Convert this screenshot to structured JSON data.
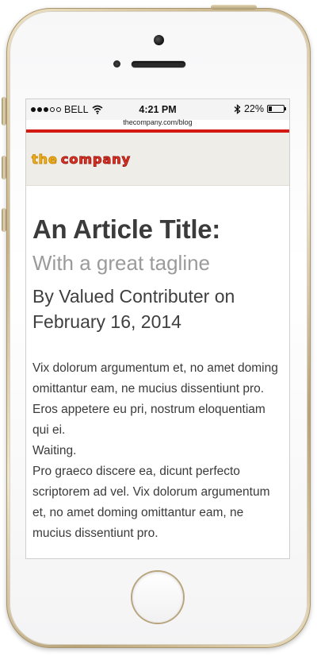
{
  "status_bar": {
    "carrier": "BELL",
    "time": "4:21 PM",
    "battery_percent": "22%",
    "battery_level": 0.22,
    "signal_dots_filled": 3,
    "signal_dots_total": 5,
    "url": "thecompany.com/blog"
  },
  "site": {
    "logo_the": "the",
    "logo_company": "company",
    "accent_color": "#d31a12"
  },
  "article": {
    "title": "An Article Title:",
    "tagline": "With a great tagline",
    "byline": "By Valued Contributer on February 16, 2014",
    "paragraphs": [
      "Vix dolorum argumentum et, no amet doming omittantur eam, ne mucius dissentiunt pro. Eros appetere eu pri, nostrum eloquentiam qui ei.",
      "Waiting.",
      "Pro graeco discere ea, dicunt perfecto scriptorem ad vel. Vix dolorum argumentum et, no amet doming omittantur eam, ne mucius dissentiunt pro."
    ]
  },
  "icons": [
    "wifi-icon",
    "bluetooth-icon",
    "battery-icon",
    "camera-icon",
    "home-button"
  ]
}
